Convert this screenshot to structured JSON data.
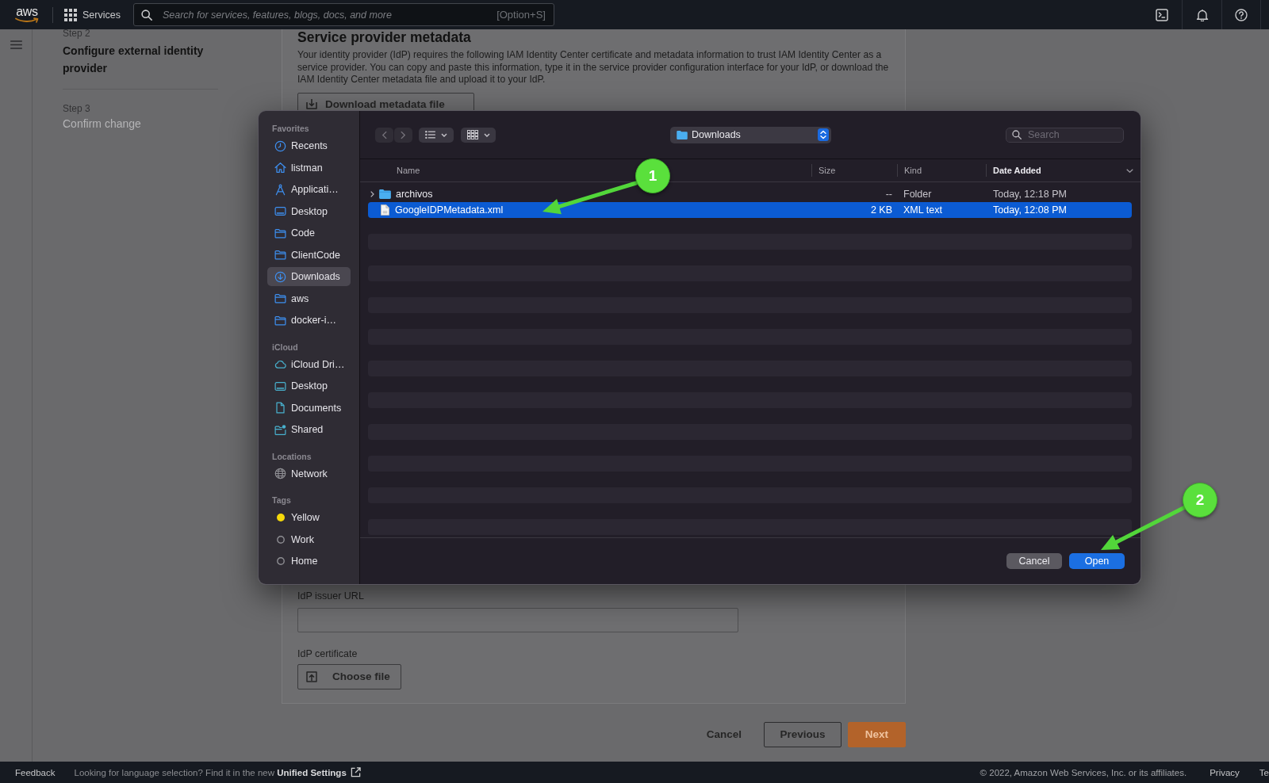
{
  "top_nav": {
    "logo": "aws",
    "services": "Services",
    "search": {
      "placeholder": "Search for services, features, blogs, docs, and more",
      "shortcut": "[Option+S]"
    }
  },
  "steps": [
    {
      "label": "Step 2",
      "title": "Configure external identity provider",
      "current": true
    },
    {
      "label": "Step 3",
      "title": "Confirm change",
      "current": false
    }
  ],
  "section": {
    "title": "Service provider metadata",
    "description": "Your identity provider (IdP) requires the following IAM Identity Center certificate and metadata information to trust IAM Identity Center as a service provider. You can copy and paste this information, type it in the service provider configuration interface for your IdP, or download the IAM Identity Center metadata file and upload it to your IdP.",
    "download_button": "Download metadata file"
  },
  "fields": [
    {
      "kind": "text",
      "label": "IdP issuer URL"
    },
    {
      "kind": "file",
      "label": "IdP certificate",
      "button": "Choose file"
    }
  ],
  "actions": [
    {
      "kind": "link",
      "label": "Cancel"
    },
    {
      "kind": "secondary",
      "label": "Previous"
    },
    {
      "kind": "primary",
      "label": "Next"
    }
  ],
  "file_dialog": {
    "sidebar": [
      {
        "heading": "Favorites",
        "items": [
          {
            "kind": "recents",
            "label": "Recents",
            "selected": false
          },
          {
            "kind": "home",
            "label": "listman",
            "selected": false
          },
          {
            "kind": "applications",
            "label": "Applicati…",
            "selected": false
          },
          {
            "kind": "desktop",
            "label": "Desktop",
            "selected": false
          },
          {
            "kind": "folder",
            "label": "Code",
            "selected": false
          },
          {
            "kind": "folder",
            "label": "ClientCode",
            "selected": false
          },
          {
            "kind": "downloads",
            "label": "Downloads",
            "selected": true
          },
          {
            "kind": "folder",
            "label": "aws",
            "selected": false
          },
          {
            "kind": "folder",
            "label": "docker-i…",
            "selected": false
          }
        ]
      },
      {
        "heading": "iCloud",
        "items": [
          {
            "kind": "cloud",
            "label": "iCloud Dri…",
            "selected": false
          },
          {
            "kind": "desktop",
            "label": "Desktop",
            "selected": false
          },
          {
            "kind": "document",
            "label": "Documents",
            "selected": false
          },
          {
            "kind": "shared",
            "label": "Shared",
            "selected": false
          }
        ]
      },
      {
        "heading": "Locations",
        "items": [
          {
            "kind": "network",
            "label": "Network",
            "selected": false
          }
        ]
      },
      {
        "heading": "Tags",
        "items": [
          {
            "kind": "tag",
            "label": "Yellow",
            "color": "#f5d90a",
            "selected": false
          },
          {
            "kind": "tag",
            "label": "Work",
            "selected": false
          },
          {
            "kind": "tag",
            "label": "Home",
            "selected": false
          }
        ]
      }
    ],
    "location": "Downloads",
    "search": {
      "placeholder": "Search"
    },
    "columns": [
      {
        "label": "Name",
        "sorted": false
      },
      {
        "label": "Size",
        "sorted": false
      },
      {
        "label": "Kind",
        "sorted": false
      },
      {
        "label": "Date Added",
        "sorted": true
      }
    ],
    "rows": [
      {
        "kind": "folder",
        "name": "archivos",
        "size": "--",
        "type": "Folder",
        "date": "Today, 12:18 PM",
        "selected": false
      },
      {
        "kind": "file",
        "name": "GoogleIDPMetadata.xml",
        "size": "2 KB",
        "type": "XML text",
        "date": "Today, 12:08 PM",
        "selected": true
      }
    ],
    "buttons": [
      {
        "kind": "secondary",
        "label": "Cancel"
      },
      {
        "kind": "default",
        "label": "Open"
      }
    ]
  },
  "annotations": [
    {
      "label": "1"
    },
    {
      "label": "2"
    }
  ],
  "footer": {
    "feedback": "Feedback",
    "language_notice": "Looking for language selection? Find it in the new",
    "settings_link": "Unified Settings",
    "copyright": "© 2022, Amazon Web Services, Inc. or its affiliates.",
    "links": [
      "Privacy",
      "Te"
    ]
  }
}
